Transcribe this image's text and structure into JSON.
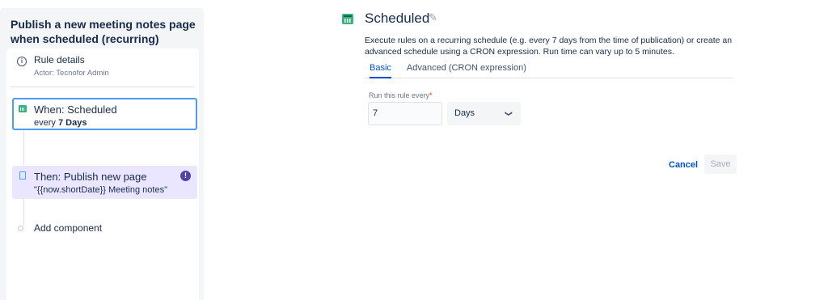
{
  "rule": {
    "title": "Publish a new meeting notes page when scheduled (recurring)",
    "details_label": "Rule details",
    "actor": "Actor: Tecnofor Admin"
  },
  "trigger": {
    "label": "When: Scheduled",
    "every_prefix": "every",
    "every_value": "7 Days",
    "icon": "calendar-icon"
  },
  "action": {
    "label": "Then: Publish new page",
    "subtitle": "\"{{now.shortDate}} Meeting notes\"",
    "icon": "page-icon",
    "warning": "!"
  },
  "add_component_label": "Add component",
  "schedule": {
    "title": "Scheduled",
    "description": "Execute rules on a recurring schedule (e.g. every 7 days from the time of publication) or create an advanced schedule using a CRON expression. Run time can vary up to 5 minutes.",
    "tabs": [
      "Basic",
      "Advanced (CRON expression)"
    ],
    "active_tab": "Basic",
    "field_label": "Run this rule every",
    "required_mark": "*",
    "interval_value": "7",
    "unit_value": "Days"
  },
  "buttons": {
    "cancel": "Cancel",
    "save": "Save"
  },
  "colors": {
    "accent": "#0052cc",
    "focus": "#4c9aff",
    "success": "#36b37e",
    "action_bg": "#eae6ff",
    "warning": "#5243aa"
  }
}
